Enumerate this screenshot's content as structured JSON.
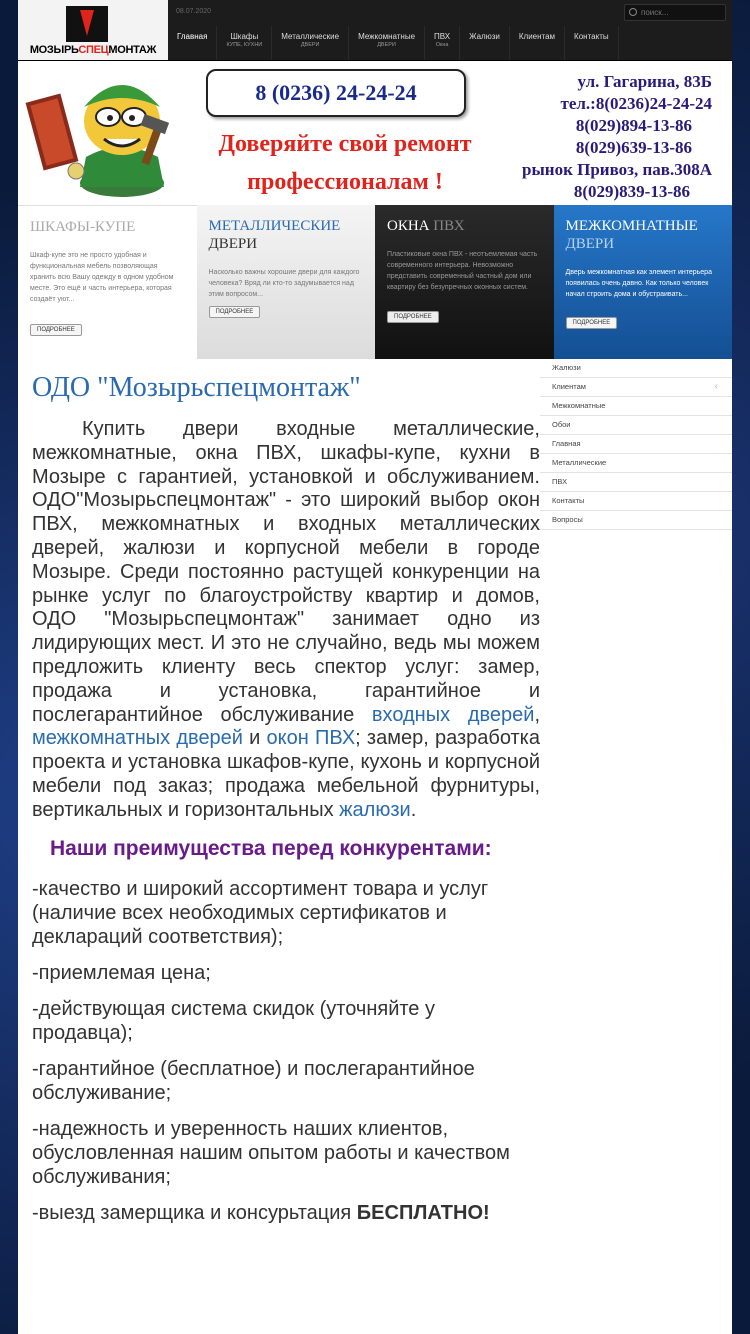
{
  "topbar": {
    "logo_text": {
      "dark1": "МОЗЫРЬ",
      "red": "СПЕЦ",
      "dark2": "МОНТАЖ"
    },
    "date": "08.07.2020",
    "search_placeholder": "поиск...",
    "nav": [
      {
        "label": "Главная",
        "sub": ""
      },
      {
        "label": "Шкафы",
        "sub": "КУПЕ, КУХНИ"
      },
      {
        "label": "Металлические",
        "sub": "ДВЕРИ"
      },
      {
        "label": "Межкомнатные",
        "sub": "ДВЕРИ"
      },
      {
        "label": "ПВХ",
        "sub": "Окна"
      },
      {
        "label": "Жалюзи",
        "sub": ""
      },
      {
        "label": "Клиентам",
        "sub": ""
      },
      {
        "label": "Контакты",
        "sub": ""
      }
    ]
  },
  "banner": {
    "phone": "8 (0236) 24-24-24",
    "slogan_line1": "Доверяйте свой ремонт",
    "slogan_line2": "профессионалам !",
    "contacts": [
      "ул. Гагарина, 83Б",
      "тел.:8(0236)24-24-24",
      "8(029)894-13-86",
      "8(029)639-13-86",
      "рынок Привоз, пав.308А",
      "8(029)839-13-86"
    ]
  },
  "categories": [
    {
      "title_a": "ШКАФЫ-КУПЕ",
      "title_b": "",
      "text": "Шкаф-купе это не просто удобная и функциональная мебель позволяющая хранить всю Вашу одежду в одном удобном месте. Это ещё и часть интерьера, которая создаёт уют...",
      "button": "ПОДРОБНЕЕ"
    },
    {
      "title_a": "МЕТАЛЛИЧЕСКИЕ",
      "title_b": "ДВЕРИ",
      "text": "Насколько важны хорошие двери для каждого человека? Вряд ли кто-то задумывается над этим вопросом...",
      "button": "ПОДРОБНЕЕ"
    },
    {
      "title_a": "ОКНА",
      "title_b": "ПВХ",
      "text": "Пластиковые окна ПВХ - неотъемлемая часть современного интерьера. Невозможно представить современный частный дом или квартиру без безупречных оконных систем.",
      "button": "ПОДРОБНЕЕ"
    },
    {
      "title_a": "МЕЖКОМНАТНЫЕ",
      "title_b": "ДВЕРИ",
      "text": "Дверь межкомнатная как элемент интерьера появилась очень давно. Как только человек начал строить дома и обустраивать...",
      "button": "ПОДРОБНЕЕ"
    }
  ],
  "main": {
    "title": "ОДО \"Мозырьспецмонтаж\"",
    "lead_1": "Купить двери входные металлические, межкомнатные, окна ПВХ, шкафы-купе, кухни в Мозыре с гарантией, установкой и обслуживанием. ОДО\"Мозырьспецмонтаж\" - это широкий выбор окон ПВХ, межкомнатных и входных металлических дверей, жалюзи и корпусной мебели в городе Мозыре. Среди постоянно растущей конкуренции на рынке услуг по благоустройству квартир и домов, ОДО \"Мозырьспецмонтаж\" занимает одно из лидирующих мест. И это не случайно, ведь мы можем предложить клиенту весь спектор услуг: замер, продажа и установка, гарантийное и послегарантийное обслуживание ",
    "link_entry_doors": "входных дверей",
    "sep_1": ", ",
    "link_interior_doors": "межкомнатных дверей",
    "sep_2": " и ",
    "link_pvc_windows": "окон ПВХ",
    "lead_2": "; замер, разработка проекта и установка шкафов-купе, кухонь и корпусной мебели под заказ; продажа мебельной фурнитуры, вертикальных и горизонтальных ",
    "link_blinds": "жалюзи",
    "lead_end": ".",
    "advantages_title": "Наши преимущества перед конкурентами:",
    "advantages": [
      "-качество и широкий ассортимент товара и услуг (наличие всех необходимых сертификатов и деклараций соответствия);",
      "-приемлемая цена;",
      "-действующая система скидок (уточняйте у продавца);",
      "-гарантийное (бесплатное) и послегарантийное обслуживание;",
      "-надежность и уверенность наших клиентов, обусловленная нашим опытом работы и качеством обслуживания;"
    ],
    "last_adv_prefix": "-выезд замерщика и консурьтация ",
    "last_adv_bold": "БЕСПЛАТНО!"
  },
  "sidebar": {
    "items": [
      "Жалюзи",
      "Клиентам",
      "Межкомнатные",
      "Обои",
      "Главная",
      "Металлические",
      "ПВХ",
      "Контакты",
      "Вопросы"
    ]
  }
}
